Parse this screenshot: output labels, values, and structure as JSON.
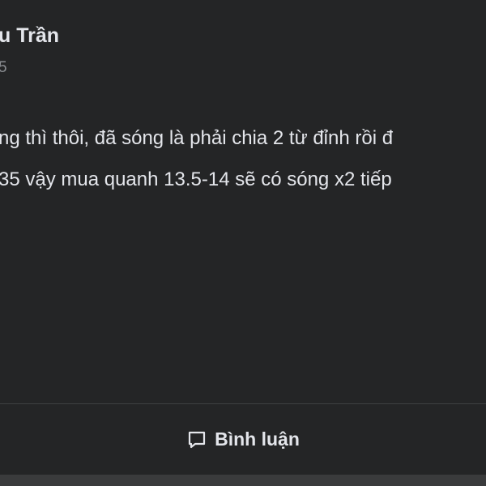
{
  "post": {
    "author_name": "u Trần",
    "meta": "5",
    "text_lines": [
      "ng thì thôi, đã sóng là phải chia 2 từ đỉnh rồi đ",
      "35 vậy mua quanh 13.5-14 sẽ có sóng x2 tiếp"
    ]
  },
  "actions": {
    "comment_label": "Bình luận",
    "comment_icon": "comment-icon"
  },
  "colors": {
    "background": "#242526",
    "text": "#e4e6eb",
    "muted": "#8a8d91",
    "divider": "#3e4042",
    "bottom_strip": "#3a3b3c"
  }
}
